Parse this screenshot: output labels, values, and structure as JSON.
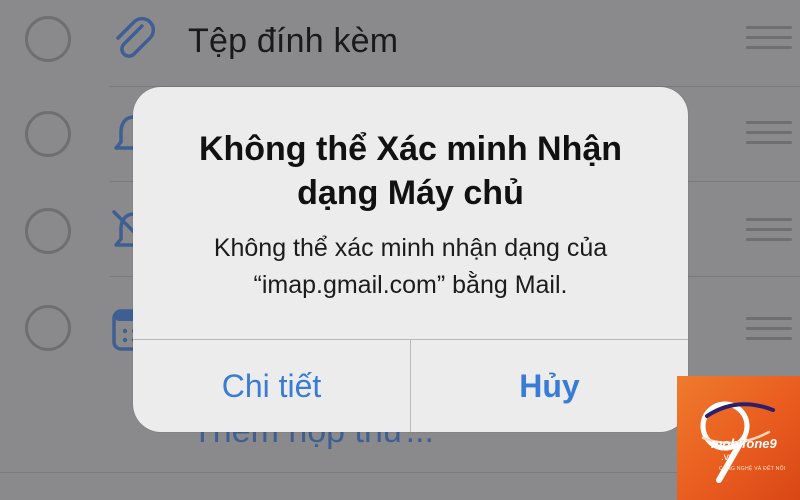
{
  "list": {
    "rows": [
      {
        "label": "Tệp đính kèm",
        "icon": "paperclip-icon"
      },
      {
        "label": "",
        "icon": "bell-icon"
      },
      {
        "label": "",
        "icon": "bell-slash-icon"
      },
      {
        "label": "",
        "icon": "calendar-icon"
      }
    ],
    "add_label": "Thêm hộp thư..."
  },
  "alert": {
    "title": "Không thể Xác minh Nhận dạng Máy chủ",
    "message": "Không thể xác minh nhận dạng của “imap.gmail.com” bằng Mail.",
    "details_button": "Chi tiết",
    "cancel_button": "Hủy"
  },
  "watermark": {
    "brand": "mobifone9",
    "domain": ".vn",
    "tagline": "CÔNG NGHỆ VÀ ĐẾT NỐI"
  },
  "colors": {
    "accent": "#3a7bd5",
    "icon_blue": "#3f5f93",
    "logo_orange": "#e95c1f"
  }
}
